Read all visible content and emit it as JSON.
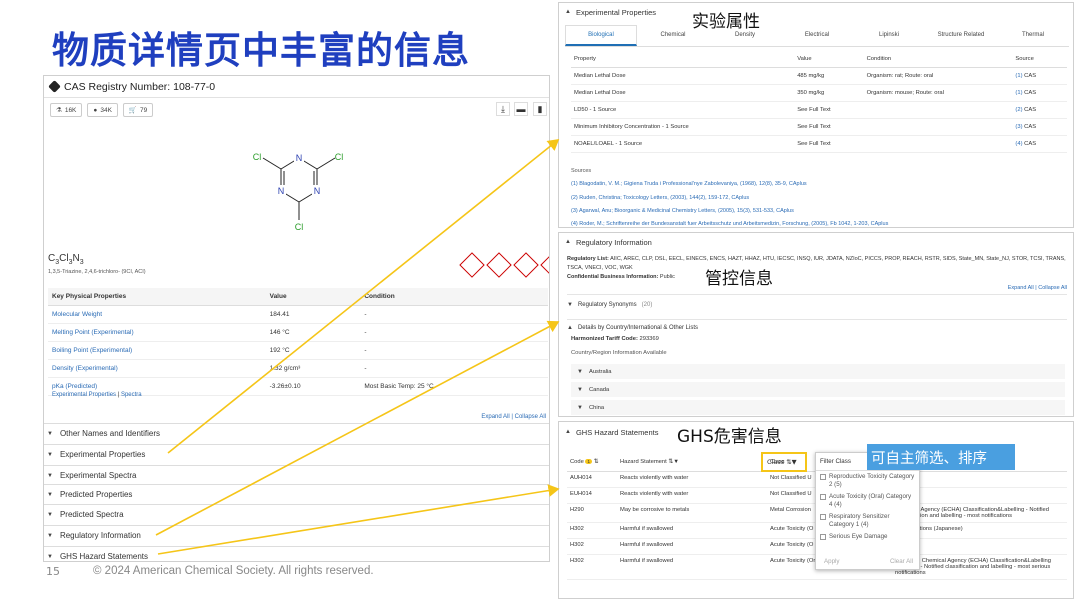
{
  "slide": {
    "title": "物质详情页中丰富的信息",
    "page_number": "15",
    "copyright": "© 2024 American Chemical Society. All rights reserved."
  },
  "callouts": {
    "exp": "实验属性",
    "reg": "管控信息",
    "ghs": "GHS危害信息",
    "filter_note": "可自主筛选、排序"
  },
  "colors": {
    "title": "#1f3fbf",
    "arrow": "#f5c518",
    "link": "#2a6bb5",
    "note_bg": "#4a9fe0"
  },
  "left": {
    "cas_title": "CAS Registry Number: 108-77-0",
    "chips": [
      {
        "icon": "flask-icon",
        "label": "16K"
      },
      {
        "icon": "user-icon",
        "label": "34K"
      },
      {
        "icon": "cart-icon",
        "label": "79"
      }
    ],
    "tools": [
      "download-icon",
      "folder-icon",
      "bookmark-icon"
    ],
    "formula": {
      "c": "C",
      "n1": "3",
      "cl": "Cl",
      "n2": "3",
      "n": "N",
      "n3": "3"
    },
    "synonym": "1,3,5-Triazine, 2,4,6-trichloro- (9CI, ACI)",
    "atoms": {
      "cl": "Cl",
      "n": "N"
    },
    "props_headers": [
      "Key Physical Properties",
      "Value",
      "Condition"
    ],
    "props": [
      {
        "name": "Molecular Weight",
        "value": "184.41",
        "cond": "-"
      },
      {
        "name": "Melting Point (Experimental)",
        "value": "146 °C",
        "cond": "-"
      },
      {
        "name": "Boiling Point (Experimental)",
        "value": "192 °C",
        "cond": "-"
      },
      {
        "name": "Density (Experimental)",
        "value": "1.32 g/cm³",
        "cond": "-"
      },
      {
        "name": "pKa (Predicted)",
        "value": "-3.26±0.10",
        "cond": "Most Basic Temp: 25 °C"
      }
    ],
    "exp_link": "Experimental Properties",
    "sep": "|",
    "spectra_link": "Spectra",
    "expand_all": "Expand All",
    "collapse_all": "Collapse All",
    "sections": [
      "Other Names and Identifiers",
      "Experimental Properties",
      "Experimental Spectra",
      "Predicted Properties",
      "Predicted Spectra",
      "Regulatory Information",
      "GHS Hazard Statements"
    ]
  },
  "exp": {
    "title": "Experimental Properties",
    "tabs": [
      "Biological",
      "Chemical",
      "Density",
      "Electrical",
      "Lipinski",
      "Structure Related",
      "Thermal"
    ],
    "headers": [
      "Property",
      "Value",
      "Condition",
      "Source"
    ],
    "rows": [
      {
        "p": "Median Lethal Dose",
        "v": "485 mg/kg",
        "c": "Organism: rat; Route: oral",
        "s": "(1)",
        "cas": "CAS"
      },
      {
        "p": "Median Lethal Dose",
        "v": "350 mg/kg",
        "c": "Organism: mouse; Route: oral",
        "s": "(1)",
        "cas": "CAS"
      },
      {
        "p": "LD50 - 1 Source",
        "v": "See Full Text",
        "c": "",
        "s": "(2)",
        "cas": "CAS"
      },
      {
        "p": "Minimum Inhibitory Concentration - 1 Source",
        "v": "See Full Text",
        "c": "",
        "s": "(3)",
        "cas": "CAS"
      },
      {
        "p": "NOAEL/LOAEL - 1 Source",
        "v": "See Full Text",
        "c": "",
        "s": "(4)",
        "cas": "CAS"
      }
    ],
    "sources_label": "Sources",
    "sources": [
      "(1) Blagodatin, V. M.; Gigiena Truda i Professional'nye Zabolevaniya, (1968), 12(8), 35-9, CAplus",
      "(2) Ruden, Christina; Toxicology Letters, (2003), 144(2), 159-172, CAplus",
      "(3) Agarwal, Anu; Bioorganic & Medicinal Chemistry Letters, (2005), 15(3), 531-533, CAplus",
      "(4) Roder, M.; Schriftenreihe der Bundesanstalt fuer Arbeitsschutz und Arbeitsmedizin, Forschung, (2005), Fb 1042, 1-203, CAplus"
    ]
  },
  "reg": {
    "title": "Regulatory Information",
    "list_label": "Regulatory List:",
    "list": "AIIC, AREC, CLP, DSL, EECL, EINECS, ENCS, HAZT, HHAZ, HTU, IECSC, INSQ, IUR, JDATA, NZIoC, PICCS, PROP, REACH, RSTR, SIDS, State_MN, State_NJ, STOR, TCSI, TRANS, TSCA, VNECI, VOC, WGK",
    "cbi_label": "Confidential Business Information:",
    "cbi": "Public",
    "expand_all": "Expand All",
    "collapse_all": "Collapse All",
    "synonyms": "Regulatory Synonyms",
    "synonyms_count": "(20)",
    "details": "Details by Country/International & Other Lists",
    "tariff_label": "Harmonized Tariff Code:",
    "tariff": "293369",
    "country_info": "Country/Region Information Available",
    "countries": [
      "Australia",
      "Canada",
      "China"
    ]
  },
  "ghs": {
    "title": "GHS Hazard Statements",
    "headers": {
      "code": "Code",
      "badge": "1",
      "statement": "Hazard Statement",
      "class": "Class"
    },
    "rows": [
      {
        "code": "AUH014",
        "stmt": "Reacts violently with water",
        "cls": "Not Classified U",
        "src": "ated"
      },
      {
        "code": "EUH014",
        "stmt": "Reacts violently with water",
        "cls": "Not Classified U",
        "src": "ated"
      },
      {
        "code": "H290",
        "stmt": "May be corrosive to metals",
        "cls": "Metal Corrosion",
        "src": "Chemical Agency (ECHA) Classification&Labelling - Notified classification and labelling - most notifications"
      },
      {
        "code": "H302",
        "stmt": "Harmful if swallowed",
        "cls": "Acute Toxicity (O",
        "src": "Classifications (Japanese)"
      },
      {
        "code": "H302",
        "stmt": "Harmful if swallowed",
        "cls": "Acute Toxicity (O",
        "src": ""
      },
      {
        "code": "H302",
        "stmt": "Harmful if swallowed",
        "cls": "Acute Toxicity (Oral) Category 4",
        "src": "European Chemical Agency (ECHA) Classification&Labelling Inventory - Notified classification and labelling - most serious notifications"
      }
    ],
    "filter_title": "Filter Class",
    "filter_items": [
      "Reproductive Toxicity Category 2 (5)",
      "Acute Toxicity (Oral) Category 4 (4)",
      "Respiratory Sensitizer Category 1 (4)",
      "Serious Eye Damage"
    ],
    "apply": "Apply",
    "clear": "Clear All"
  }
}
